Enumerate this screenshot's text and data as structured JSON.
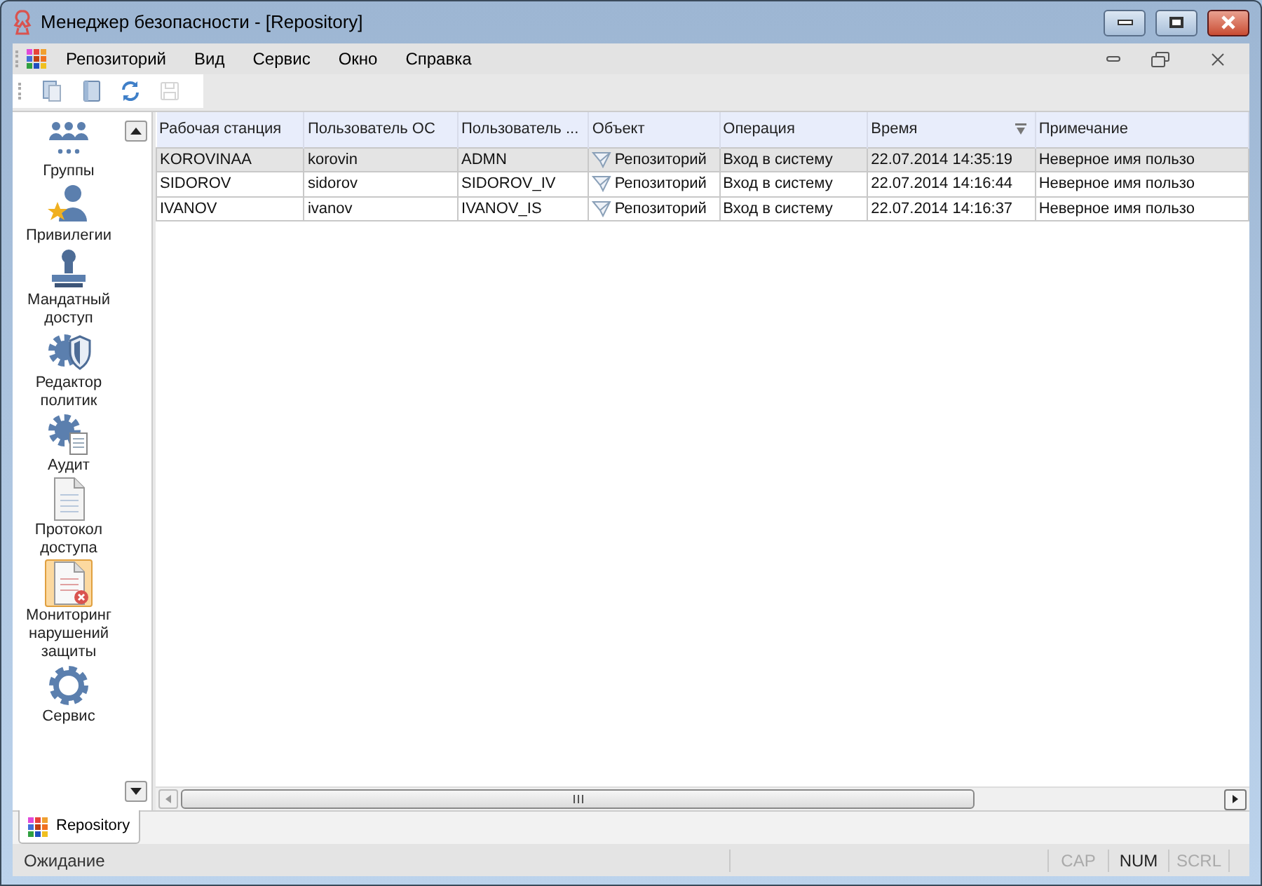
{
  "window": {
    "title": "Менеджер безопасности - [Repository]"
  },
  "menu": [
    "Репозиторий",
    "Вид",
    "Сервис",
    "Окно",
    "Справка"
  ],
  "toolbar": [
    {
      "kind": "copy",
      "disabled": false
    },
    {
      "kind": "document",
      "disabled": false
    },
    {
      "kind": "refresh",
      "disabled": false
    },
    {
      "kind": "save",
      "disabled": true
    }
  ],
  "sidebar": {
    "items": [
      {
        "label": "Группы",
        "kind": "groups",
        "selected": false
      },
      {
        "label": "Привилегии",
        "kind": "privileges",
        "selected": false
      },
      {
        "label": "Мандатный доступ",
        "kind": "stamp",
        "selected": false
      },
      {
        "label": "Редактор политик",
        "kind": "policy",
        "selected": false
      },
      {
        "label": "Аудит",
        "kind": "audit",
        "selected": false
      },
      {
        "label": "Протокол доступа",
        "kind": "log",
        "selected": false
      },
      {
        "label": "Мониторинг нарушений защиты",
        "kind": "violations",
        "selected": true
      },
      {
        "label": "Сервис",
        "kind": "service",
        "selected": false
      }
    ]
  },
  "table": {
    "columns": [
      {
        "label": "Рабочая станция"
      },
      {
        "label": "Пользователь ОС"
      },
      {
        "label": "Пользователь ..."
      },
      {
        "label": "Объект"
      },
      {
        "label": "Операция"
      },
      {
        "label": "Время",
        "filter": true
      },
      {
        "label": "Примечание"
      }
    ],
    "rows": [
      {
        "selected": true,
        "cells": [
          "KOROVINAA",
          "korovin",
          "ADMN",
          "Репозиторий",
          "Вход в систему",
          "22.07.2014 14:35:19",
          "Неверное имя пользо"
        ]
      },
      {
        "selected": false,
        "cells": [
          "SIDOROV",
          "sidorov",
          "SIDOROV_IV",
          "Репозиторий",
          "Вход в систему",
          "22.07.2014 14:16:44",
          "Неверное имя пользо"
        ]
      },
      {
        "selected": false,
        "cells": [
          "IVANOV",
          "ivanov",
          "IVANOV_IS",
          "Репозиторий",
          "Вход в систему",
          "22.07.2014 14:16:37",
          "Неверное имя пользо"
        ]
      }
    ]
  },
  "tabs": [
    {
      "label": "Repository",
      "selected": true
    }
  ],
  "status_bar": {
    "text": "Ожидание",
    "indicators": [
      {
        "label": "CAP",
        "on": false
      },
      {
        "label": "NUM",
        "on": true
      },
      {
        "label": "SCRL",
        "on": false
      }
    ]
  }
}
